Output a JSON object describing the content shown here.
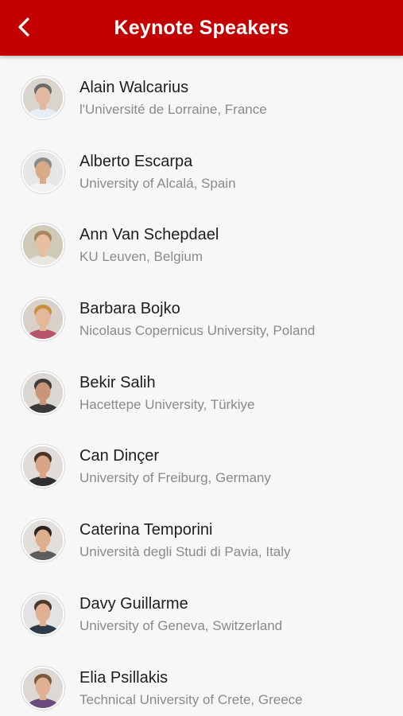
{
  "header": {
    "title": "Keynote Speakers",
    "back_icon": "chevron-left-icon",
    "background_color": "#c20000"
  },
  "speakers": [
    {
      "name": "Alain Walcarius",
      "affiliation": "l'Université de Lorraine, France",
      "skin": "#e2b9a0",
      "hair": "#6b6b6b",
      "shirt": "#e8eef5",
      "bg": "#d9d4cc"
    },
    {
      "name": "Alberto Escarpa",
      "affiliation": "University of Alcalá, Spain",
      "skin": "#d9a988",
      "hair": "#8a8a8a",
      "shirt": "#f2f2f2",
      "bg": "#e6e6e6"
    },
    {
      "name": "Ann Van Schepdael",
      "affiliation": "KU Leuven, Belgium",
      "skin": "#e6bfa3",
      "hair": "#a88458",
      "shirt": "#e9e6df",
      "bg": "#cfcab8"
    },
    {
      "name": "Barbara Bojko",
      "affiliation": "Nicolaus Copernicus University, Poland",
      "skin": "#e5b89a",
      "hair": "#c98f3d",
      "shirt": "#b8556b",
      "bg": "#d8d1c9"
    },
    {
      "name": "Bekir Salih",
      "affiliation": "Hacettepe University, Türkiye",
      "skin": "#c89576",
      "hair": "#3c3c3c",
      "shirt": "#3a3a3a",
      "bg": "#dad6d2"
    },
    {
      "name": "Can Dinçer",
      "affiliation": "University of Freiburg, Germany",
      "skin": "#d7a585",
      "hair": "#4a3325",
      "shirt": "#2f2f33",
      "bg": "#e0ddd8"
    },
    {
      "name": "Caterina Temporini",
      "affiliation": "Università degli Studi di Pavia, Italy",
      "skin": "#dfae8c",
      "hair": "#2a2320",
      "shirt": "#5d5d5d",
      "bg": "#e2dfdb"
    },
    {
      "name": "Davy Guillarme",
      "affiliation": "University of Geneva, Switzerland",
      "skin": "#dfb092",
      "hair": "#4a3a2e",
      "shirt": "#2d3a4a",
      "bg": "#e3e3e3"
    },
    {
      "name": "Elia Psillakis",
      "affiliation": "Technical University of Crete, Greece",
      "skin": "#e0b093",
      "hair": "#7a5a3a",
      "shirt": "#6b4a7e",
      "bg": "#dcd8d3"
    }
  ]
}
